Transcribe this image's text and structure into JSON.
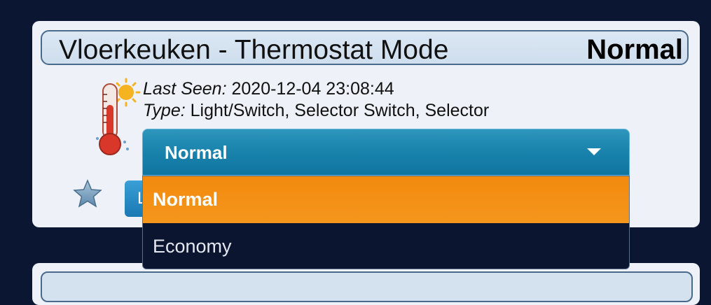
{
  "device": {
    "name": "Vloerkeuken - Thermostat Mode",
    "status": "Normal",
    "last_seen_label": "Last Seen:",
    "last_seen_value": "2020-12-04 23:08:44",
    "type_label": "Type:",
    "type_value": "Light/Switch, Selector Switch, Selector",
    "icon": "thermometer-sun-icon",
    "favorite_icon": "star-icon",
    "log_button_label": "L"
  },
  "selector": {
    "selected": "Normal",
    "options": [
      "Normal",
      "Economy"
    ]
  },
  "colors": {
    "background": "#0b1633",
    "card": "#eef2f8",
    "select_blue": "#1a84ad",
    "option_highlight": "#f28a0e"
  }
}
